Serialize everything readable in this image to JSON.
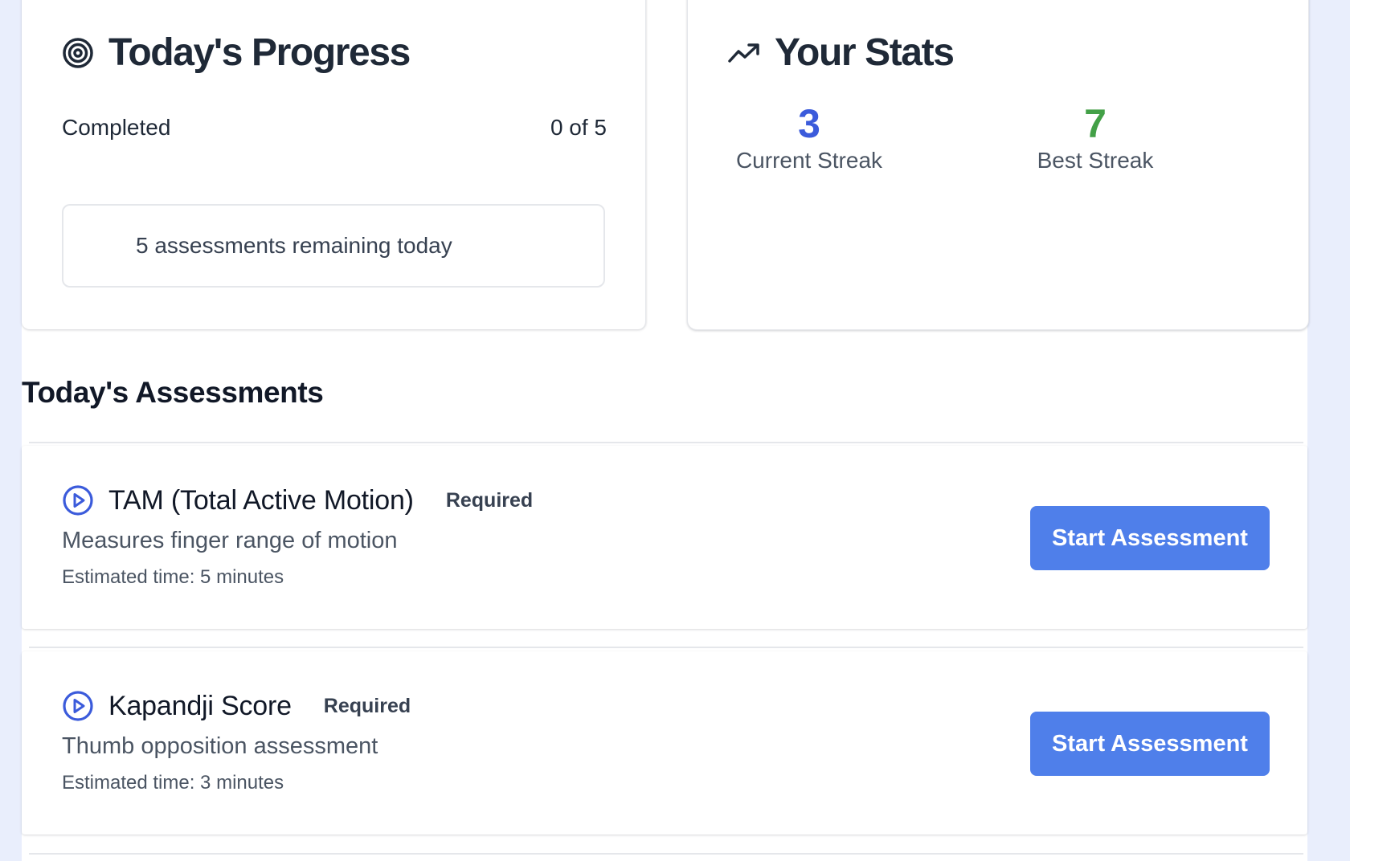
{
  "progress_card": {
    "title": "Today's Progress",
    "icon": "target-icon",
    "completed_label": "Completed",
    "completed_value": "0 of 5",
    "completed_count": 0,
    "total_count": 5,
    "remaining_text": "5 assessments remaining today"
  },
  "stats_card": {
    "title": "Your Stats",
    "icon": "trending-up-icon",
    "current_streak": {
      "value": "3",
      "label": "Current Streak",
      "color": "#3b5bdb"
    },
    "best_streak": {
      "value": "7",
      "label": "Best Streak",
      "color": "#43a047"
    }
  },
  "assessments_section": {
    "title": "Today's Assessments",
    "items": [
      {
        "name": "TAM (Total Active Motion)",
        "badge": "Required",
        "description": "Measures finger range of motion",
        "time": "Estimated time: 5 minutes",
        "button_label": "Start Assessment",
        "icon": "play-circle-icon"
      },
      {
        "name": "Kapandji Score",
        "badge": "Required",
        "description": "Thumb opposition assessment",
        "time": "Estimated time: 3 minutes",
        "button_label": "Start Assessment",
        "icon": "play-circle-icon"
      }
    ]
  },
  "colors": {
    "accent": "#4f7fea",
    "icon_blue": "#3b5bdb",
    "page_background": "#e9eefc"
  }
}
